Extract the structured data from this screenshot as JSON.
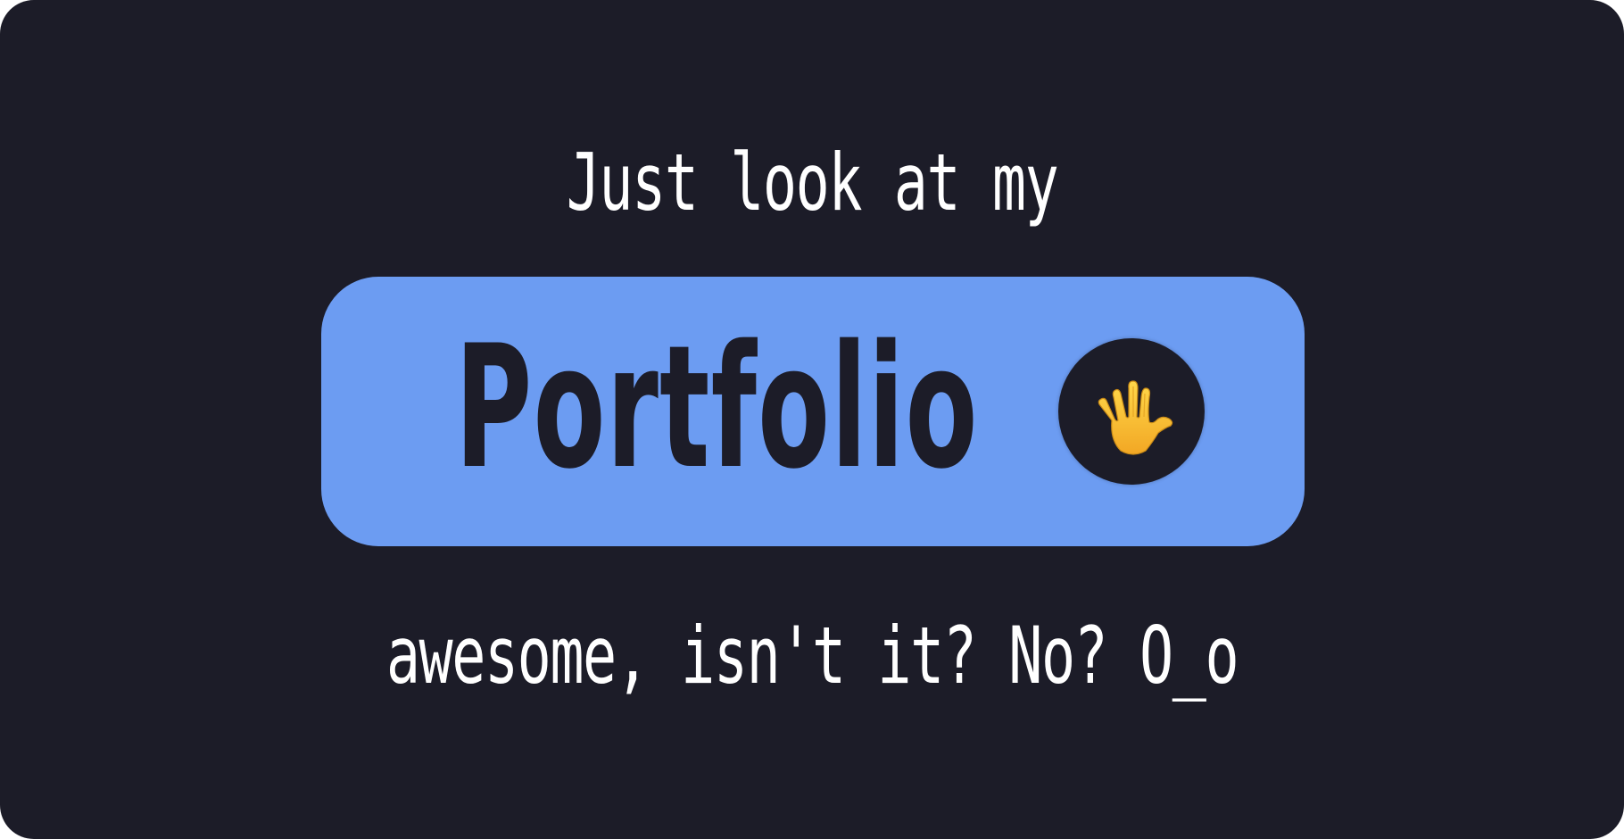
{
  "headline": {
    "top": "Just look at my",
    "highlight": "Portfolio",
    "bottom": "awesome, isn't it? No? O_o"
  },
  "badge": {
    "icon": "vulcan-salute-hand-icon"
  },
  "colors": {
    "background": "#1c1c28",
    "accent": "#6c9cf2",
    "text": "#ffffff",
    "dark_text": "#1c1c28",
    "hand": "#f6c531"
  }
}
